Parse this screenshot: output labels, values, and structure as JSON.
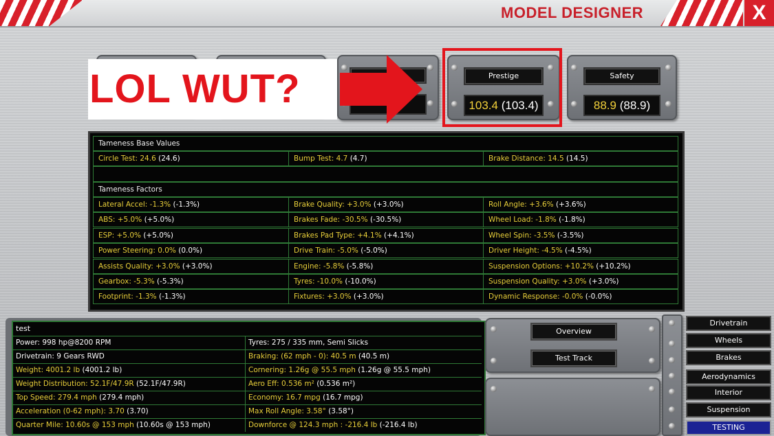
{
  "window": {
    "title": "MODEL DESIGNER",
    "close_label": "X"
  },
  "meme": {
    "text": "LOL WUT?"
  },
  "stats": {
    "prestige": {
      "label": "Prestige",
      "value": "103.4",
      "base": "(103.4)"
    },
    "safety": {
      "label": "Safety",
      "value": "88.9",
      "base": "(88.9)"
    }
  },
  "tameness": {
    "base_title": "Tameness Base Values",
    "base_values": [
      {
        "label": "Circle Test: 24.6",
        "paren": "(24.6)"
      },
      {
        "label": "Bump Test: 4.7",
        "paren": "(4.7)"
      },
      {
        "label": "Brake Distance: 14.5",
        "paren": "(14.5)"
      }
    ],
    "factors_title": "Tameness Factors",
    "factors": [
      [
        {
          "label": "Lateral Accel: -1.3%",
          "paren": "(-1.3%)"
        },
        {
          "label": "Brake Quality: +3.0%",
          "paren": "(+3.0%)"
        },
        {
          "label": "Roll Angle: +3.6%",
          "paren": "(+3.6%)"
        }
      ],
      [
        {
          "label": "ABS: +5.0%",
          "paren": "(+5.0%)"
        },
        {
          "label": "Brakes Fade: -30.5%",
          "paren": "(-30.5%)"
        },
        {
          "label": "Wheel Load: -1.8%",
          "paren": "(-1.8%)"
        }
      ],
      [
        {
          "label": "ESP: +5.0%",
          "paren": "(+5.0%)"
        },
        {
          "label": "Brakes Pad Type: +4.1%",
          "paren": "(+4.1%)"
        },
        {
          "label": "Wheel Spin: -3.5%",
          "paren": "(-3.5%)"
        }
      ],
      [
        {
          "label": "Power Steering: 0.0%",
          "paren": "(0.0%)"
        },
        {
          "label": "Drive Train: -5.0%",
          "paren": "(-5.0%)"
        },
        {
          "label": "Driver Height: -4.5%",
          "paren": "(-4.5%)"
        }
      ],
      [
        {
          "label": "Assists Quality: +3.0%",
          "paren": "(+3.0%)"
        },
        {
          "label": "Engine: -5.8%",
          "paren": "(-5.8%)"
        },
        {
          "label": "Suspension Options: +10.2%",
          "paren": "(+10.2%)"
        }
      ],
      [
        {
          "label": "Gearbox: -5.3%",
          "paren": "(-5.3%)"
        },
        {
          "label": "Tyres: -10.0%",
          "paren": "(-10.0%)"
        },
        {
          "label": "Suspension Quality: +3.0%",
          "paren": "(+3.0%)"
        }
      ],
      [
        {
          "label": "Footprint: -1.3%",
          "paren": "(-1.3%)"
        },
        {
          "label": "Fixtures: +3.0%",
          "paren": "(+3.0%)"
        },
        {
          "label": "Dynamic Response: -0.0%",
          "paren": "(-0.0%)"
        }
      ]
    ]
  },
  "info": {
    "name": "test",
    "rows": [
      [
        {
          "label": "Power: 998 hp@8200 RPM",
          "paren": "",
          "white": true
        },
        {
          "label": "Tyres: 275 / 335 mm, Semi Slicks",
          "paren": "",
          "white": true
        }
      ],
      [
        {
          "label": "Drivetrain: 9 Gears RWD",
          "paren": "",
          "white": true
        },
        {
          "label": "Braking: (62 mph - 0): 40.5 m",
          "paren": "(40.5 m)"
        }
      ],
      [
        {
          "label": "Weight: 4001.2 lb",
          "paren": "(4001.2 lb)"
        },
        {
          "label": "Cornering: 1.26g @ 55.5 mph",
          "paren": "(1.26g @ 55.5 mph)"
        }
      ],
      [
        {
          "label": "Weight Distribution: 52.1F/47.9R",
          "paren": "(52.1F/47.9R)"
        },
        {
          "label": "Aero Eff: 0.536 m²",
          "paren": "(0.536 m²)"
        }
      ],
      [
        {
          "label": "Top Speed: 279.4 mph",
          "paren": "(279.4 mph)"
        },
        {
          "label": "Economy: 16.7 mpg",
          "paren": "(16.7 mpg)"
        }
      ],
      [
        {
          "label": "Acceleration (0-62 mph): 3.70",
          "paren": "(3.70)"
        },
        {
          "label": "Max Roll Angle: 3.58°",
          "paren": "(3.58°)"
        }
      ],
      [
        {
          "label": "Quarter Mile: 10.60s @ 153 mph",
          "paren": "(10.60s @ 153 mph)"
        },
        {
          "label": "Downforce @ 124.3 mph : -216.4 lb",
          "paren": "(-216.4 lb)"
        }
      ]
    ]
  },
  "actions": {
    "overview": "Overview",
    "test_track": "Test Track"
  },
  "nav": [
    "Drivetrain",
    "Wheels",
    "Brakes",
    "Aerodynamics",
    "Interior",
    "Suspension",
    "TESTING"
  ],
  "colors": {
    "accent_red": "#d8202a",
    "label_yellow": "#e8cf3a",
    "grid_green": "#2f7a36",
    "active_blue": "#1b2394"
  }
}
